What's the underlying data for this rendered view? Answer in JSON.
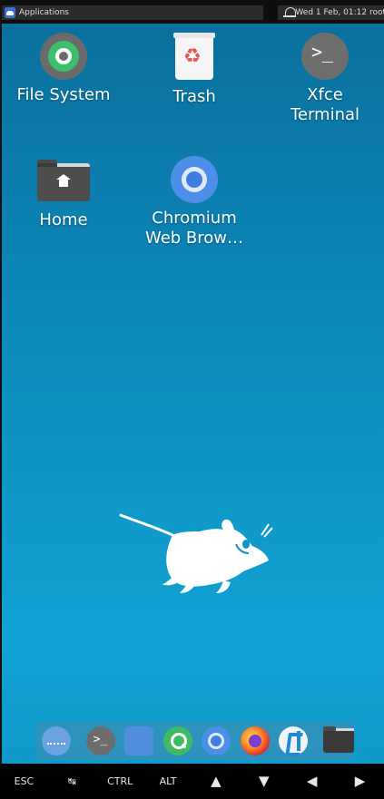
{
  "top_panel": {
    "menu_label": "Applications",
    "clock": "Wed 1 Feb, 01:12",
    "user": "root"
  },
  "desktop_icons": [
    {
      "label": "File System",
      "icon": "filesystem-icon"
    },
    {
      "label": "Trash",
      "icon": "trash-icon"
    },
    {
      "label": "Xfce Terminal",
      "icon": "terminal-icon"
    },
    {
      "label": "Home",
      "icon": "home-folder-icon"
    },
    {
      "label": "Chromium Web Brow…",
      "icon": "chromium-icon"
    }
  ],
  "dock": {
    "items": [
      "show-desktop-icon",
      "terminal-icon",
      "files-icon",
      "search-icon",
      "chromium-icon",
      "firefox-icon",
      "vscode-icon",
      "folder-icon"
    ],
    "terminal_prompt": ">_"
  },
  "keybar": {
    "keys": [
      "ESC",
      "↹",
      "CTRL",
      "ALT",
      "▲",
      "▼",
      "◀",
      "▶"
    ]
  },
  "colors": {
    "desktop_top": "#0a6e9a",
    "desktop_bottom": "#11a2d3",
    "panel": "#2b2b2b"
  }
}
